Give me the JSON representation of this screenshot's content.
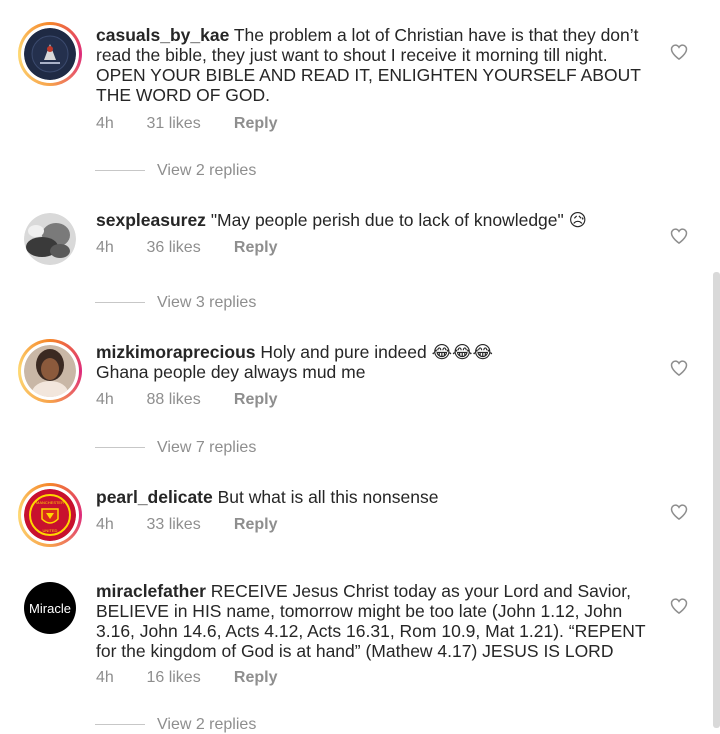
{
  "comments": [
    {
      "username": "casuals_by_kae",
      "text": "The problem a lot of Christian have is that they don’t read the bible, they just want to shout I receive it morning till night. OPEN YOUR BIBLE AND READ IT, ENLIGHTEN YOURSELF ABOUT THE WORD OF GOD.",
      "age": "4h",
      "likes": "31 likes",
      "reply_label": "Reply",
      "view_replies": "View 2 replies",
      "avatar": "dark-logo-avatar"
    },
    {
      "username": "sexpleasurez",
      "text": "\"May people perish due to lack of knowledge\" 😥",
      "age": "4h",
      "likes": "36 likes",
      "reply_label": "Reply",
      "view_replies": "View 3 replies",
      "avatar": "bw-photo-avatar"
    },
    {
      "username": "mizkimoraprecious",
      "text": "Holy and pure indeed 😂😂😂",
      "text_line2": "Ghana people dey always mud me",
      "age": "4h",
      "likes": "88 likes",
      "reply_label": "Reply",
      "view_replies": "View 7 replies",
      "avatar": "portrait-photo-avatar"
    },
    {
      "username": "pearl_delicate",
      "text": "But what is all this nonsense",
      "age": "4h",
      "likes": "33 likes",
      "reply_label": "Reply",
      "avatar": "club-crest-avatar",
      "avatar_badge_text": "MANCHESTER UNITED"
    },
    {
      "username": "miraclefather",
      "text": "RECEIVE Jesus Christ today as your Lord and Savior, BELIEVE in HIS name, tomorrow might be too late (John 1.12, John 3.16, John 14.6, Acts 4.12, Acts 16.31, Rom 10.9, Mat 1.21). “REPENT for the kingdom of God is at hand” (Mathew 4.17) JESUS IS LORD",
      "age": "4h",
      "likes": "16 likes",
      "reply_label": "Reply",
      "view_replies": "View 2 replies",
      "avatar": "text-avatar",
      "avatar_text": "Miracle"
    }
  ],
  "icons": {
    "like": "heart-outline-icon"
  },
  "colors": {
    "text": "#262626",
    "secondary": "#8e8e8e",
    "story_ring_start": "#f58529",
    "story_ring_end": "#dd2a7b"
  }
}
